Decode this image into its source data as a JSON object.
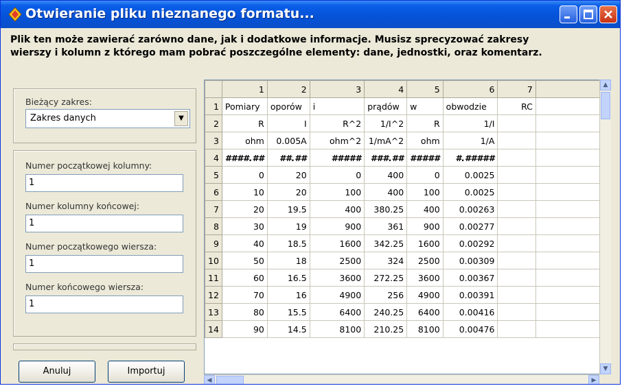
{
  "window": {
    "title": "Otwieranie pliku nieznanego formatu...",
    "description_line1": "Plik ten może zawierać zarówno dane, jak i dodatkowe informacje. Musisz sprecyzować zakresy",
    "description_line2": "wierszy i kolumn z którego mam pobrać poszczególne elementy: dane, jednostki, oraz komentarz."
  },
  "left_panel": {
    "current_range_label": "Bieżący zakres:",
    "current_range_value": "Zakres danych",
    "start_column_label": "Numer początkowej kolumny:",
    "start_column_value": "1",
    "end_column_label": "Numer kolumny końcowej:",
    "end_column_value": "1",
    "start_row_label": "Numer początkowego wiersza:",
    "start_row_value": "1",
    "end_row_label": "Numer końcowego wiersza:",
    "end_row_value": "1",
    "cancel_button": "Anuluj",
    "import_button": "Importuj"
  },
  "grid": {
    "column_headers": [
      "",
      "1",
      "2",
      "3",
      "4",
      "5",
      "6",
      "7",
      ""
    ],
    "rows": [
      {
        "n": "1",
        "cells": [
          "Pomiary",
          "oporów",
          "i",
          "prądów",
          "w",
          "obwodzie",
          "RC",
          ""
        ]
      },
      {
        "n": "2",
        "cells": [
          "R",
          "I",
          "R^2",
          "1/I^2",
          "R",
          "1/I",
          "",
          ""
        ]
      },
      {
        "n": "3",
        "cells": [
          "ohm",
          "0.005A",
          "ohm^2",
          "1/mA^2",
          "ohm",
          "1/A",
          "",
          ""
        ]
      },
      {
        "n": "4",
        "cells": [
          "####.##",
          "##.##",
          "#####",
          "###.##",
          "#####",
          "#.#####",
          "",
          ""
        ]
      },
      {
        "n": "5",
        "cells": [
          "0",
          "20",
          "0",
          "400",
          "0",
          "0.0025",
          "",
          ""
        ]
      },
      {
        "n": "6",
        "cells": [
          "10",
          "20",
          "100",
          "400",
          "100",
          "0.0025",
          "",
          ""
        ]
      },
      {
        "n": "7",
        "cells": [
          "20",
          "19.5",
          "400",
          "380.25",
          "400",
          "0.00263",
          "",
          ""
        ]
      },
      {
        "n": "8",
        "cells": [
          "30",
          "19",
          "900",
          "361",
          "900",
          "0.00277",
          "",
          ""
        ]
      },
      {
        "n": "9",
        "cells": [
          "40",
          "18.5",
          "1600",
          "342.25",
          "1600",
          "0.00292",
          "",
          ""
        ]
      },
      {
        "n": "10",
        "cells": [
          "50",
          "18",
          "2500",
          "324",
          "2500",
          "0.00309",
          "",
          ""
        ]
      },
      {
        "n": "11",
        "cells": [
          "60",
          "16.5",
          "3600",
          "272.25",
          "3600",
          "0.00367",
          "",
          ""
        ]
      },
      {
        "n": "12",
        "cells": [
          "70",
          "16",
          "4900",
          "256",
          "4900",
          "0.00391",
          "",
          ""
        ]
      },
      {
        "n": "13",
        "cells": [
          "80",
          "15.5",
          "6400",
          "240.25",
          "6400",
          "0.00416",
          "",
          ""
        ]
      },
      {
        "n": "14",
        "cells": [
          "90",
          "14.5",
          "8100",
          "210.25",
          "8100",
          "0.00476",
          "",
          ""
        ]
      }
    ]
  },
  "icons": {
    "app": "app-icon",
    "minimize": "minimize-icon",
    "maximize": "maximize-icon",
    "close": "close-icon"
  }
}
